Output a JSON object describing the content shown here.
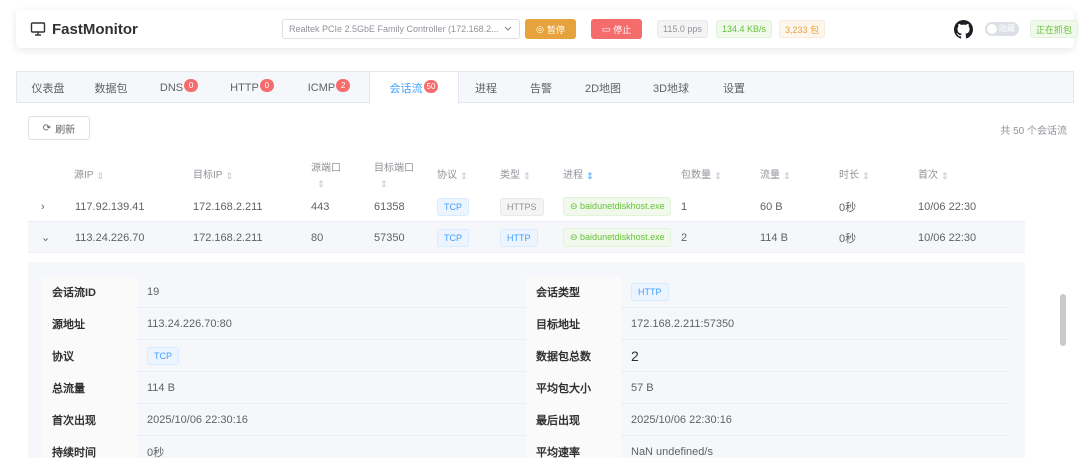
{
  "header": {
    "title": "FastMonitor",
    "interface": "Realtek PCIe 2.5GbE Family Controller (172.168.2...",
    "pause_label": "暂停",
    "stop_label": "停止",
    "pps": "115.0 pps",
    "rate": "134.4 KB/s",
    "packets": "3,233 包",
    "toggle_text": "隐藏",
    "capture_status": "正在抓包"
  },
  "tabs": [
    {
      "label": "仪表盘",
      "badge": ""
    },
    {
      "label": "数据包",
      "badge": ""
    },
    {
      "label": "DNS",
      "badge": "0"
    },
    {
      "label": "HTTP",
      "badge": "0"
    },
    {
      "label": "ICMP",
      "badge": "2"
    },
    {
      "label": "会话流",
      "badge": "50"
    },
    {
      "label": "进程",
      "badge": ""
    },
    {
      "label": "告警",
      "badge": ""
    },
    {
      "label": "2D地图",
      "badge": ""
    },
    {
      "label": "3D地球",
      "badge": ""
    },
    {
      "label": "设置",
      "badge": ""
    }
  ],
  "toolbar": {
    "refresh_label": "刷新",
    "total": "共 50 个会话流"
  },
  "table": {
    "columns": {
      "src_ip": "源IP",
      "dst_ip": "目标IP",
      "src_port": "源端口",
      "dst_port": "目标端口",
      "protocol": "协议",
      "type": "类型",
      "process": "进程",
      "packets": "包数量",
      "bytes": "流量",
      "duration": "时长",
      "first_seen": "首次"
    },
    "rows": [
      {
        "expand": "›",
        "src_ip": "117.92.139.41",
        "dst_ip": "172.168.2.211",
        "src_port": "443",
        "dst_port": "61358",
        "protocol": "TCP",
        "type": "HTTPS",
        "process": "baidunetdiskhost.exe",
        "packets": "1",
        "bytes": "60 B",
        "duration": "0秒",
        "first_seen": "10/06 22:30"
      },
      {
        "expand": "⌄",
        "src_ip": "113.24.226.70",
        "dst_ip": "172.168.2.211",
        "src_port": "80",
        "dst_port": "57350",
        "protocol": "TCP",
        "type": "HTTP",
        "process": "baidunetdiskhost.exe",
        "packets": "2",
        "bytes": "114 B",
        "duration": "0秒",
        "first_seen": "10/06 22:30"
      }
    ]
  },
  "detail": {
    "flow_id_label": "会话流ID",
    "flow_id": "19",
    "flow_type_label": "会话类型",
    "flow_type": "HTTP",
    "src_addr_label": "源地址",
    "src_addr": "113.24.226.70:80",
    "dst_addr_label": "目标地址",
    "dst_addr": "172.168.2.211:57350",
    "protocol_label": "协议",
    "protocol": "TCP",
    "packets_label": "数据包总数",
    "packets": "2",
    "bytes_label": "总流量",
    "bytes": "114 B",
    "avg_size_label": "平均包大小",
    "avg_size": "57 B",
    "first_label": "首次出现",
    "first": "2025/10/06 22:30:16",
    "last_label": "最后出现",
    "last": "2025/10/06 22:30:16",
    "duration_label": "持续时间",
    "duration": "0秒",
    "avg_rate_label": "平均速率",
    "avg_rate": "NaN undefined/s"
  },
  "colors": {
    "accent": "#409eff",
    "warning": "#e6a23c",
    "danger": "#f56c6c",
    "success": "#67c23a"
  },
  "icons": [
    "monitor-icon",
    "chevron-down-icon",
    "pause-icon",
    "stop-icon",
    "github-icon",
    "refresh-icon",
    "sort-icon",
    "expand-icon",
    "collapse-icon",
    "link-icon"
  ]
}
